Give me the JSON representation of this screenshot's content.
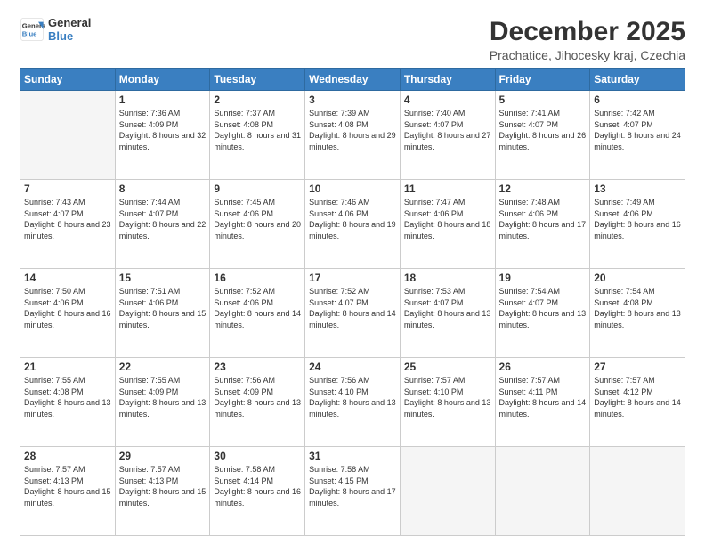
{
  "logo": {
    "line1": "General",
    "line2": "Blue"
  },
  "title": "December 2025",
  "subtitle": "Prachatice, Jihocesky kraj, Czechia",
  "weekdays": [
    "Sunday",
    "Monday",
    "Tuesday",
    "Wednesday",
    "Thursday",
    "Friday",
    "Saturday"
  ],
  "weeks": [
    [
      {
        "day": "",
        "sunrise": "",
        "sunset": "",
        "daylight": ""
      },
      {
        "day": "1",
        "sunrise": "7:36 AM",
        "sunset": "4:09 PM",
        "daylight": "8 hours and 32 minutes."
      },
      {
        "day": "2",
        "sunrise": "7:37 AM",
        "sunset": "4:08 PM",
        "daylight": "8 hours and 31 minutes."
      },
      {
        "day": "3",
        "sunrise": "7:39 AM",
        "sunset": "4:08 PM",
        "daylight": "8 hours and 29 minutes."
      },
      {
        "day": "4",
        "sunrise": "7:40 AM",
        "sunset": "4:07 PM",
        "daylight": "8 hours and 27 minutes."
      },
      {
        "day": "5",
        "sunrise": "7:41 AM",
        "sunset": "4:07 PM",
        "daylight": "8 hours and 26 minutes."
      },
      {
        "day": "6",
        "sunrise": "7:42 AM",
        "sunset": "4:07 PM",
        "daylight": "8 hours and 24 minutes."
      }
    ],
    [
      {
        "day": "7",
        "sunrise": "7:43 AM",
        "sunset": "4:07 PM",
        "daylight": "8 hours and 23 minutes."
      },
      {
        "day": "8",
        "sunrise": "7:44 AM",
        "sunset": "4:07 PM",
        "daylight": "8 hours and 22 minutes."
      },
      {
        "day": "9",
        "sunrise": "7:45 AM",
        "sunset": "4:06 PM",
        "daylight": "8 hours and 20 minutes."
      },
      {
        "day": "10",
        "sunrise": "7:46 AM",
        "sunset": "4:06 PM",
        "daylight": "8 hours and 19 minutes."
      },
      {
        "day": "11",
        "sunrise": "7:47 AM",
        "sunset": "4:06 PM",
        "daylight": "8 hours and 18 minutes."
      },
      {
        "day": "12",
        "sunrise": "7:48 AM",
        "sunset": "4:06 PM",
        "daylight": "8 hours and 17 minutes."
      },
      {
        "day": "13",
        "sunrise": "7:49 AM",
        "sunset": "4:06 PM",
        "daylight": "8 hours and 16 minutes."
      }
    ],
    [
      {
        "day": "14",
        "sunrise": "7:50 AM",
        "sunset": "4:06 PM",
        "daylight": "8 hours and 16 minutes."
      },
      {
        "day": "15",
        "sunrise": "7:51 AM",
        "sunset": "4:06 PM",
        "daylight": "8 hours and 15 minutes."
      },
      {
        "day": "16",
        "sunrise": "7:52 AM",
        "sunset": "4:06 PM",
        "daylight": "8 hours and 14 minutes."
      },
      {
        "day": "17",
        "sunrise": "7:52 AM",
        "sunset": "4:07 PM",
        "daylight": "8 hours and 14 minutes."
      },
      {
        "day": "18",
        "sunrise": "7:53 AM",
        "sunset": "4:07 PM",
        "daylight": "8 hours and 13 minutes."
      },
      {
        "day": "19",
        "sunrise": "7:54 AM",
        "sunset": "4:07 PM",
        "daylight": "8 hours and 13 minutes."
      },
      {
        "day": "20",
        "sunrise": "7:54 AM",
        "sunset": "4:08 PM",
        "daylight": "8 hours and 13 minutes."
      }
    ],
    [
      {
        "day": "21",
        "sunrise": "7:55 AM",
        "sunset": "4:08 PM",
        "daylight": "8 hours and 13 minutes."
      },
      {
        "day": "22",
        "sunrise": "7:55 AM",
        "sunset": "4:09 PM",
        "daylight": "8 hours and 13 minutes."
      },
      {
        "day": "23",
        "sunrise": "7:56 AM",
        "sunset": "4:09 PM",
        "daylight": "8 hours and 13 minutes."
      },
      {
        "day": "24",
        "sunrise": "7:56 AM",
        "sunset": "4:10 PM",
        "daylight": "8 hours and 13 minutes."
      },
      {
        "day": "25",
        "sunrise": "7:57 AM",
        "sunset": "4:10 PM",
        "daylight": "8 hours and 13 minutes."
      },
      {
        "day": "26",
        "sunrise": "7:57 AM",
        "sunset": "4:11 PM",
        "daylight": "8 hours and 14 minutes."
      },
      {
        "day": "27",
        "sunrise": "7:57 AM",
        "sunset": "4:12 PM",
        "daylight": "8 hours and 14 minutes."
      }
    ],
    [
      {
        "day": "28",
        "sunrise": "7:57 AM",
        "sunset": "4:13 PM",
        "daylight": "8 hours and 15 minutes."
      },
      {
        "day": "29",
        "sunrise": "7:57 AM",
        "sunset": "4:13 PM",
        "daylight": "8 hours and 15 minutes."
      },
      {
        "day": "30",
        "sunrise": "7:58 AM",
        "sunset": "4:14 PM",
        "daylight": "8 hours and 16 minutes."
      },
      {
        "day": "31",
        "sunrise": "7:58 AM",
        "sunset": "4:15 PM",
        "daylight": "8 hours and 17 minutes."
      },
      {
        "day": "",
        "sunrise": "",
        "sunset": "",
        "daylight": ""
      },
      {
        "day": "",
        "sunrise": "",
        "sunset": "",
        "daylight": ""
      },
      {
        "day": "",
        "sunrise": "",
        "sunset": "",
        "daylight": ""
      }
    ]
  ]
}
